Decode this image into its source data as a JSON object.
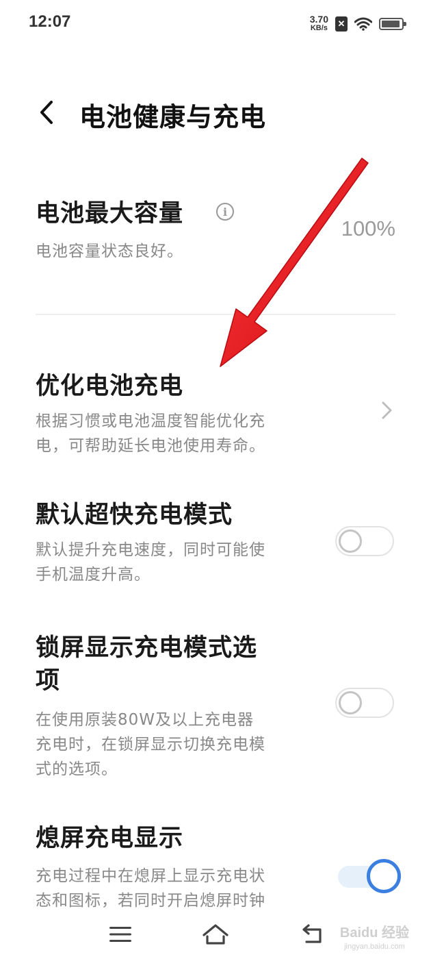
{
  "status_bar": {
    "time": "12:07",
    "net_speed_value": "3.70",
    "net_speed_unit": "KB/s",
    "sim_icon": "no-sim-icon",
    "wifi_icon": "wifi-icon",
    "battery_icon": "battery-icon"
  },
  "header": {
    "back_icon": "back-arrow-icon",
    "title": "电池健康与充电"
  },
  "battery_capacity": {
    "title": "电池最大容量",
    "info_icon": "info-icon",
    "subtitle": "电池容量状态良好。",
    "value": "100%"
  },
  "settings": [
    {
      "title": "优化电池充电",
      "subtitle_lines": [
        "根据习惯或电池温度智能优化充",
        "电，可帮助延长电池使用寿命。"
      ],
      "control": "chevron-right-icon"
    },
    {
      "title": "默认超快充电模式",
      "subtitle_lines": [
        "默认提升充电速度，同时可能使",
        "手机温度升高。"
      ],
      "control": "toggle",
      "enabled": false
    },
    {
      "title_lines": [
        "锁屏显示充电模式选",
        "项"
      ],
      "subtitle_lines": [
        "在使用原装80W及以上充电器",
        "充电时，在锁屏显示切换充电模",
        "式的选项。"
      ],
      "control": "toggle",
      "enabled": false
    },
    {
      "title": "熄屏充电显示",
      "subtitle_lines": [
        "充电过程中在熄屏上显示充电状",
        "态和图标，若同时开启熄屏时钟"
      ],
      "control": "toggle",
      "enabled": true
    }
  ],
  "nav_bar": {
    "menu_icon": "menu-icon",
    "home_icon": "home-icon",
    "back_icon": "back-icon"
  },
  "watermark": {
    "text": "Baidu 经验",
    "subtext": "jingyan.baidu.com"
  },
  "colors": {
    "accent": "#3b7fe0",
    "annotation_arrow": "#e8141b"
  }
}
